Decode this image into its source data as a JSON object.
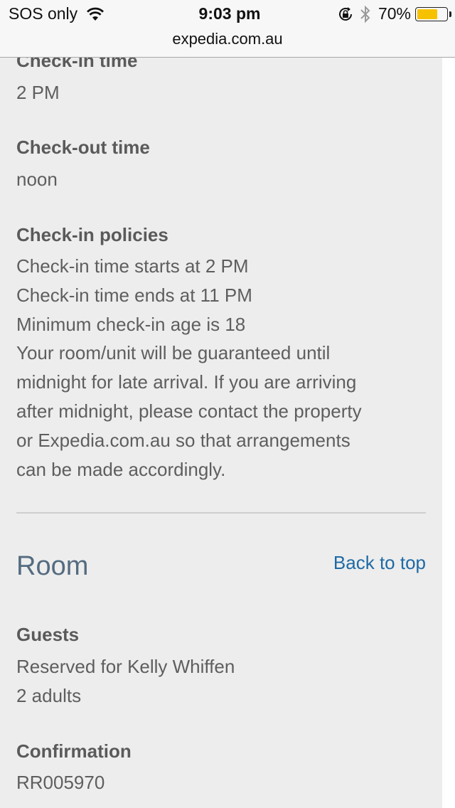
{
  "status_bar": {
    "carrier": "SOS only",
    "time": "9:03 pm",
    "battery_percent_label": "70%",
    "battery_level": 0.7,
    "battery_color": "#f6c200",
    "url": "expedia.com.au",
    "icons": [
      "wifi-icon",
      "orientation-lock-icon",
      "bluetooth-icon",
      "battery-icon"
    ]
  },
  "policies": {
    "checkin_time": {
      "label": "Check-in time",
      "value": "2 PM"
    },
    "checkout_time": {
      "label": "Check-out time",
      "value": "noon"
    },
    "checkin_policies": {
      "label": "Check-in policies",
      "lines": [
        "Check-in time starts at 2 PM",
        "Check-in time ends at 11 PM",
        "Minimum check-in age is 18",
        "Your room/unit will be guaranteed until",
        "midnight for late arrival. If you are arriving",
        "after midnight, please contact the property",
        "or Expedia.com.au so that arrangements",
        "can be made accordingly."
      ]
    }
  },
  "room": {
    "title": "Room",
    "back_to_top": "Back to top",
    "guests": {
      "label": "Guests",
      "reserved_for": "Reserved for Kelly Whiffen",
      "count": "2 adults"
    },
    "confirmation": {
      "label": "Confirmation",
      "value": "RR005970"
    }
  },
  "colors": {
    "panel_bg": "#ededed",
    "text": "#5e5e5e",
    "heading": "#546b80",
    "link": "#1f6aa5"
  }
}
